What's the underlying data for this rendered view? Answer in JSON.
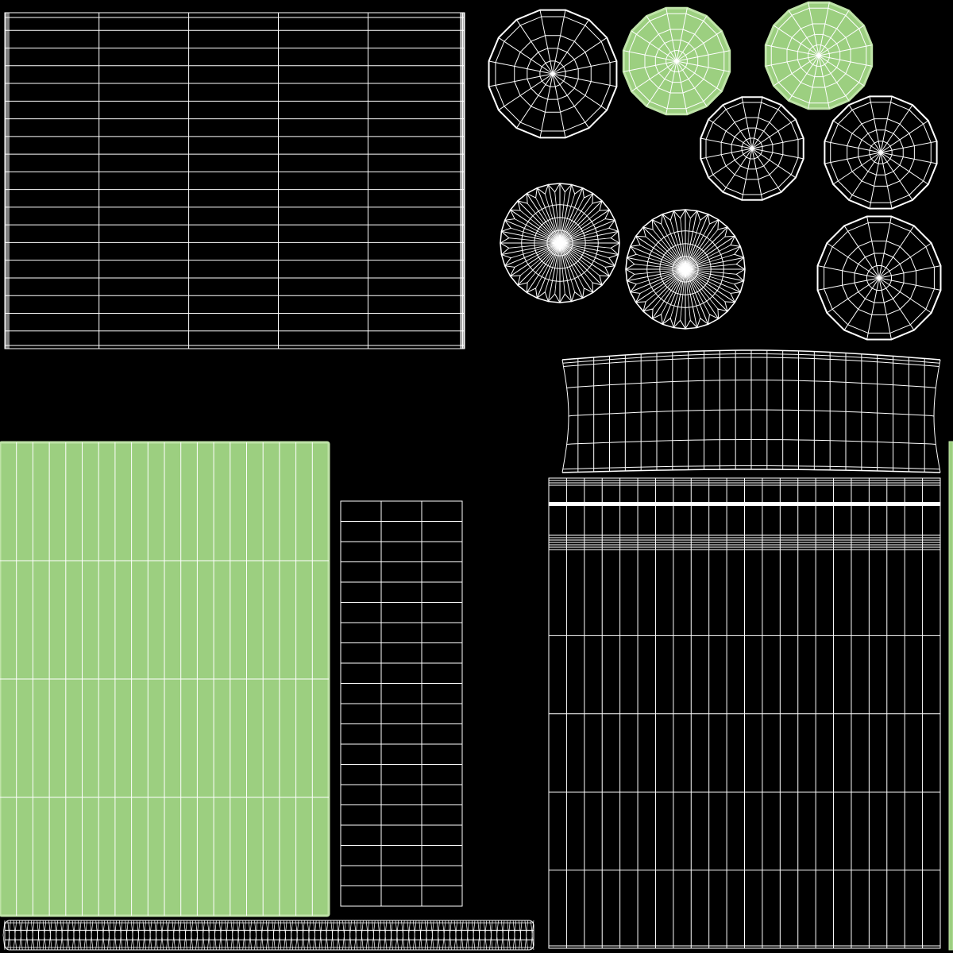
{
  "colors": {
    "background": "#000000",
    "wire": "#ffffff",
    "selected_fill": "#9ccf80",
    "selected_border": "#bfe3a8"
  },
  "islands": [
    {
      "name": "uv-island-top-grid",
      "kind": "grid",
      "selected": false,
      "columns": 5,
      "rows": 19
    },
    {
      "name": "uv-island-disc-1",
      "kind": "disc",
      "selected": false,
      "segments": 16,
      "rings": 4
    },
    {
      "name": "uv-island-disc-2",
      "kind": "disc",
      "selected": true,
      "segments": 16,
      "rings": 4
    },
    {
      "name": "uv-island-disc-3",
      "kind": "disc",
      "selected": true,
      "segments": 16,
      "rings": 4
    },
    {
      "name": "uv-island-disc-4",
      "kind": "disc",
      "selected": false,
      "segments": 16,
      "rings": 4
    },
    {
      "name": "uv-island-disc-5",
      "kind": "disc",
      "selected": false,
      "segments": 16,
      "rings": 4
    },
    {
      "name": "uv-island-serrated-disc-1",
      "kind": "serrated-disc",
      "selected": false,
      "segments": 32,
      "rings": 3
    },
    {
      "name": "uv-island-serrated-disc-2",
      "kind": "serrated-disc",
      "selected": false,
      "segments": 32,
      "rings": 3
    },
    {
      "name": "uv-island-disc-6",
      "kind": "disc",
      "selected": false,
      "segments": 16,
      "rings": 4
    },
    {
      "name": "uv-island-curved-band",
      "kind": "curved-band",
      "selected": false,
      "columns": 24,
      "rows": 4
    },
    {
      "name": "uv-island-left-panel",
      "kind": "grid",
      "selected": true,
      "columns": 20,
      "rows": 4
    },
    {
      "name": "uv-island-middle-column",
      "kind": "grid",
      "selected": false,
      "columns": 3,
      "rows": 20
    },
    {
      "name": "uv-island-right-panel",
      "kind": "grid",
      "selected": false,
      "columns": 22,
      "rows": 5
    },
    {
      "name": "uv-island-bottom-strip",
      "kind": "strip",
      "selected": false,
      "columns": 90,
      "rows": 3
    },
    {
      "name": "uv-island-edge-sliver",
      "kind": "sliver",
      "selected": true
    }
  ]
}
